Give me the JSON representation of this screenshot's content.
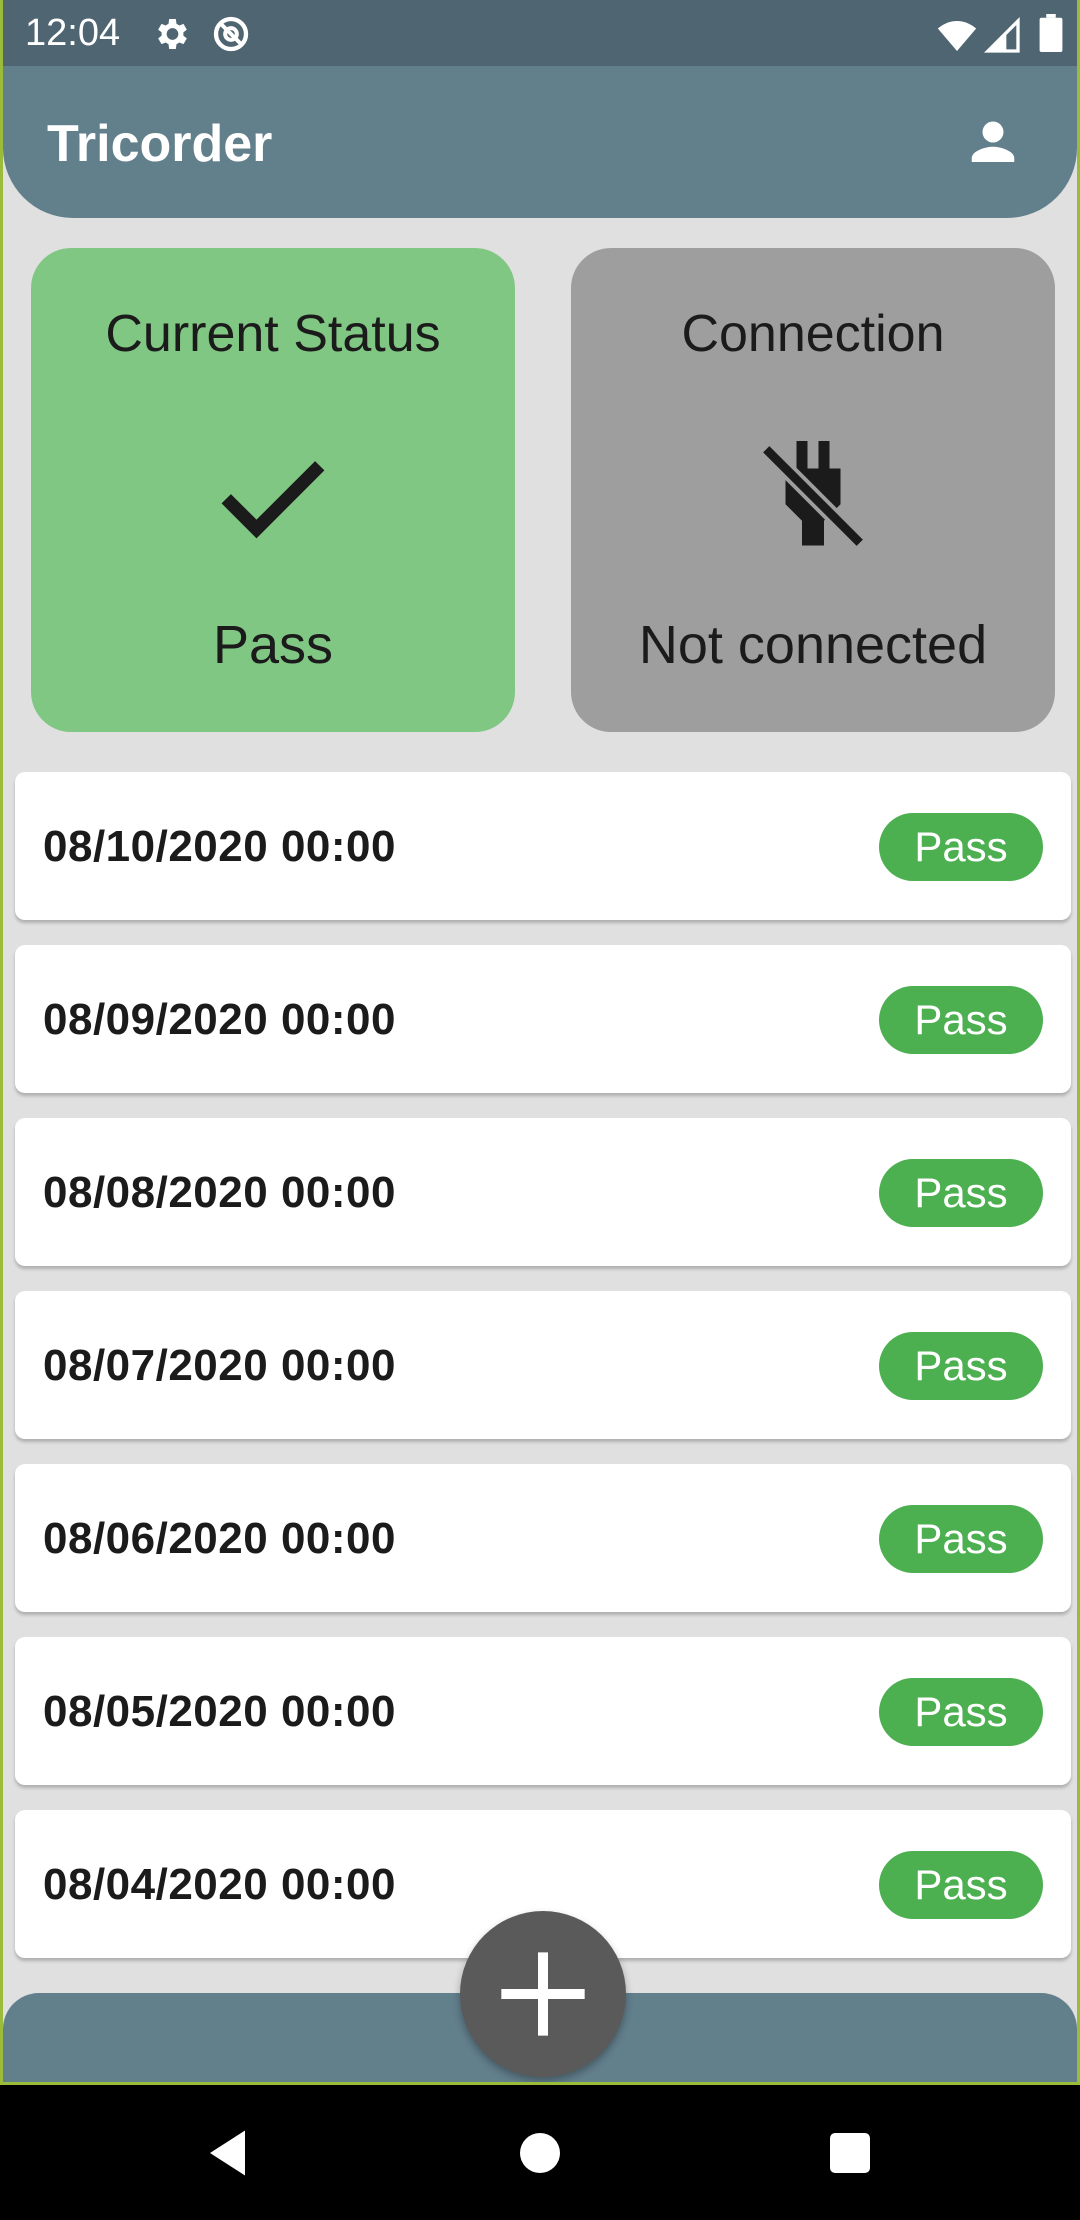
{
  "status_bar": {
    "time": "12:04",
    "icons": [
      "gear-icon",
      "at-circle-icon",
      "wifi-icon",
      "signal-icon",
      "battery-icon"
    ]
  },
  "app_bar": {
    "title": "Tricorder",
    "action_icon": "account-icon"
  },
  "cards": {
    "status": {
      "title": "Current Status",
      "value": "Pass",
      "icon": "check-icon",
      "color": "#81c784"
    },
    "connection": {
      "title": "Connection",
      "value": "Not connected",
      "icon": "power-off-icon",
      "color": "#9e9e9e"
    }
  },
  "history": [
    {
      "date": "08/10/2020 00:00",
      "result": "Pass"
    },
    {
      "date": "08/09/2020 00:00",
      "result": "Pass"
    },
    {
      "date": "08/08/2020 00:00",
      "result": "Pass"
    },
    {
      "date": "08/07/2020 00:00",
      "result": "Pass"
    },
    {
      "date": "08/06/2020 00:00",
      "result": "Pass"
    },
    {
      "date": "08/05/2020 00:00",
      "result": "Pass"
    },
    {
      "date": "08/04/2020 00:00",
      "result": "Pass"
    }
  ],
  "fab": {
    "icon": "plus-icon"
  },
  "colors": {
    "app_bar": "#627f8c",
    "status_bar": "#4f6672",
    "pass_badge": "#4caf50",
    "fab": "#5a5a5a"
  }
}
